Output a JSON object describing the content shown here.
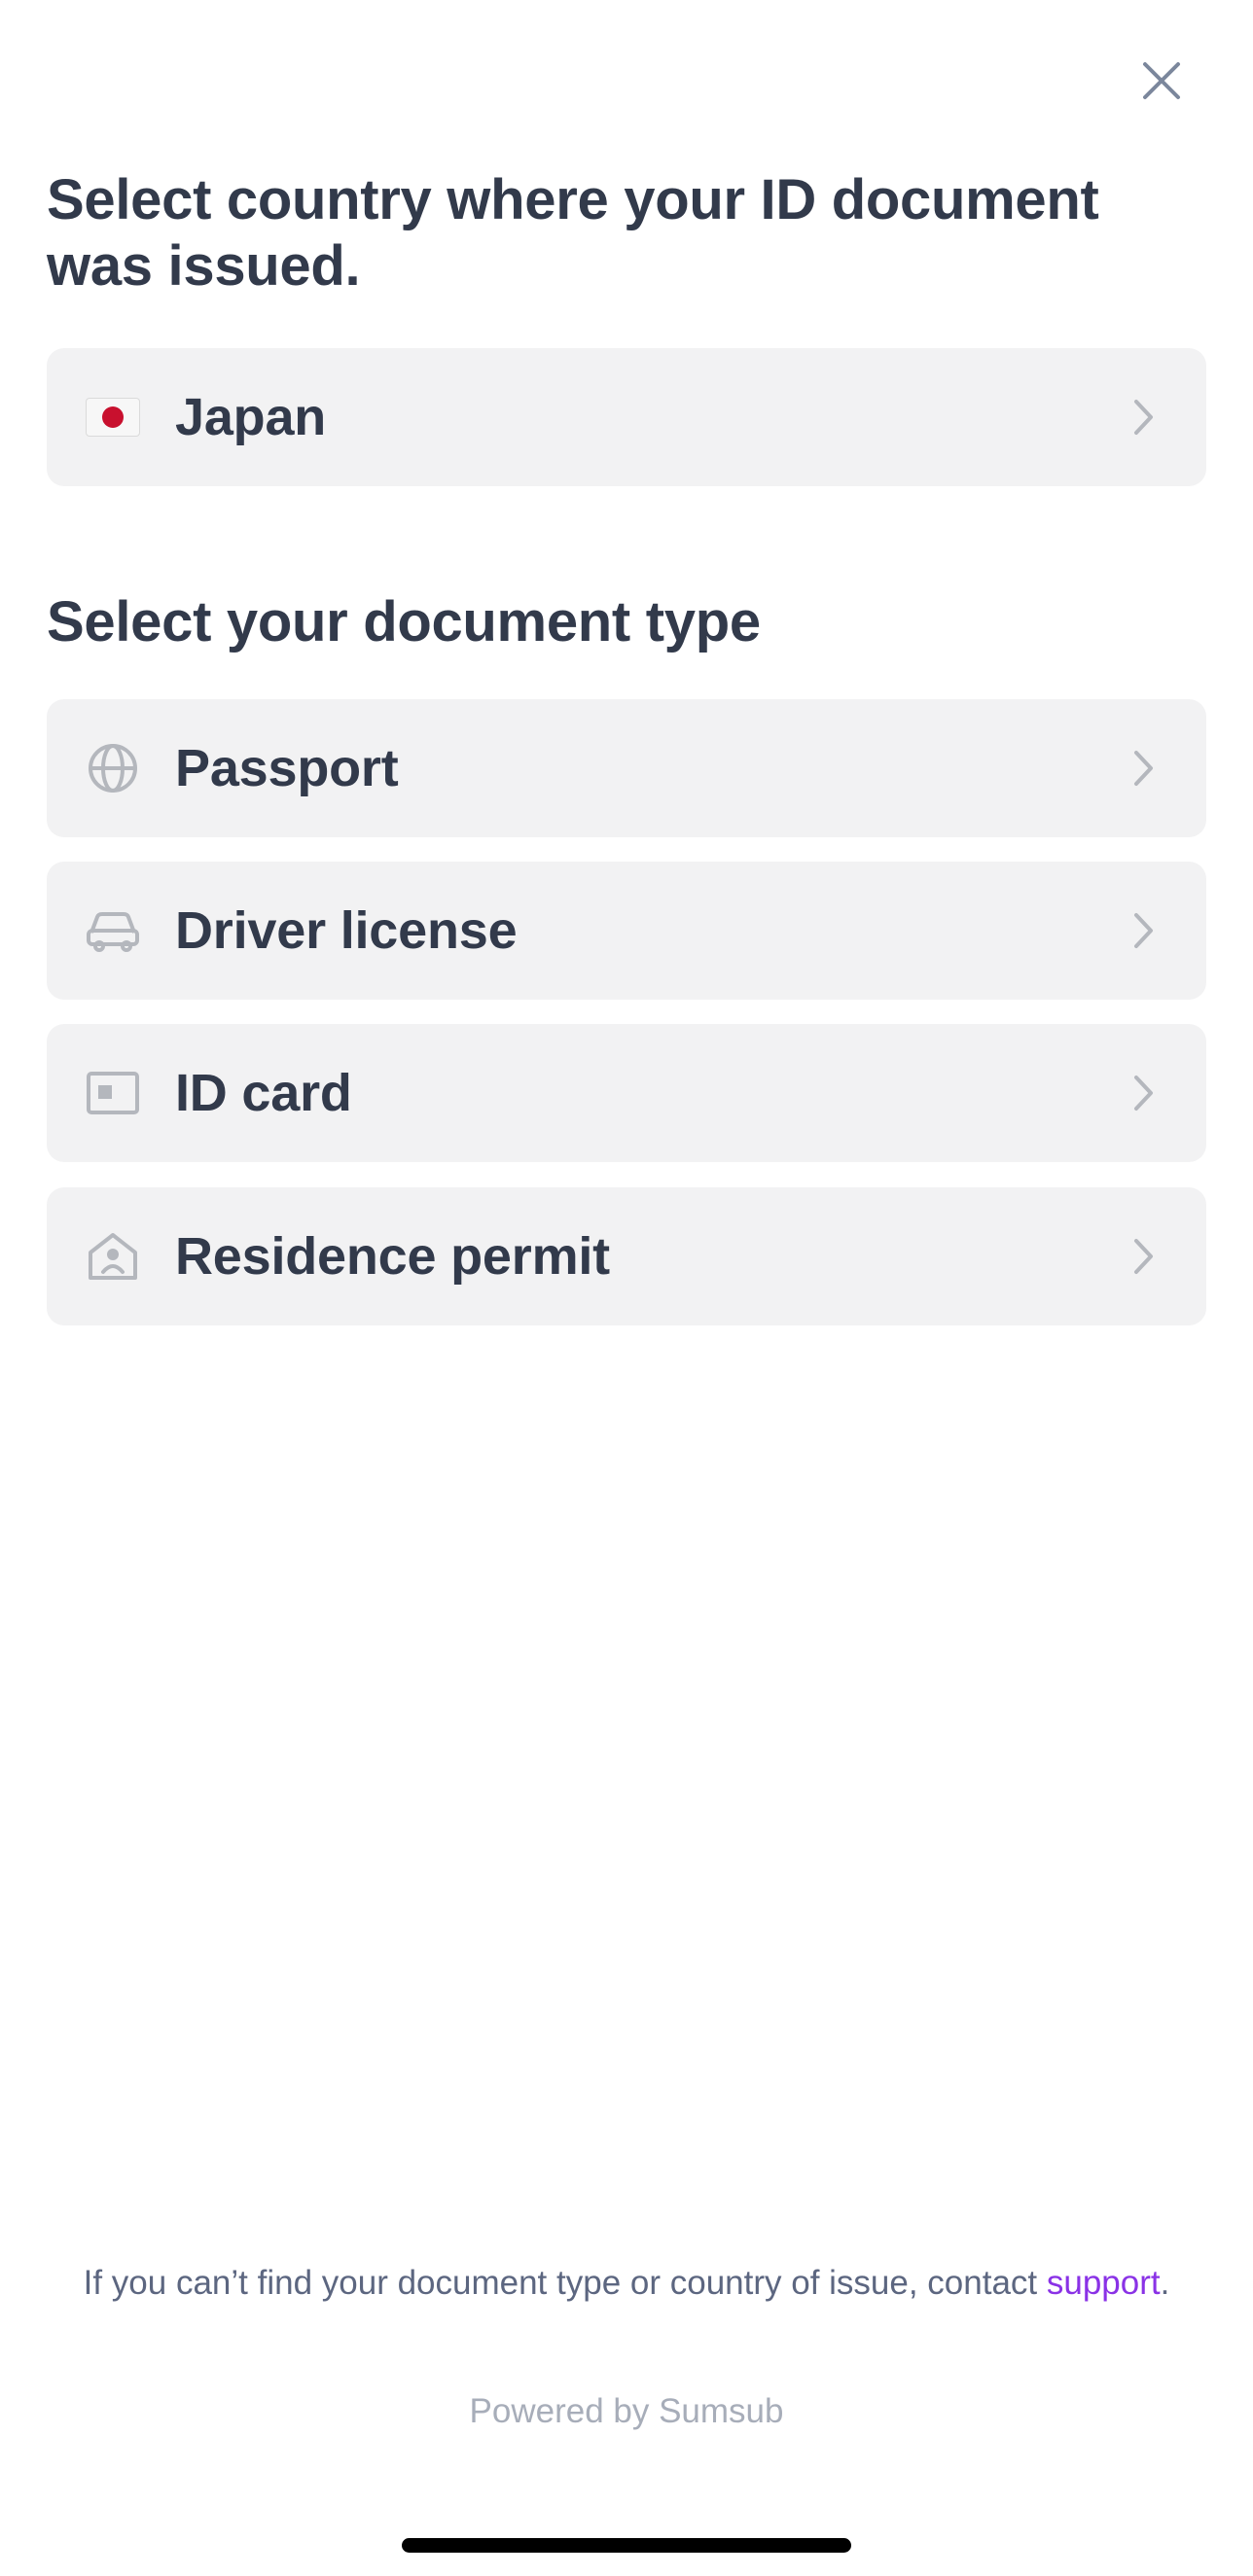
{
  "close_icon": "close-icon",
  "country_section": {
    "heading": "Select country where your ID document was issued.",
    "selected_country": {
      "name": "Japan",
      "flag_icon": "japan-flag-icon"
    }
  },
  "document_section": {
    "heading": "Select your document type",
    "types": [
      {
        "label": "Passport",
        "icon": "globe-icon"
      },
      {
        "label": "Driver license",
        "icon": "car-icon"
      },
      {
        "label": "ID card",
        "icon": "id-card-icon"
      },
      {
        "label": "Residence permit",
        "icon": "house-person-icon"
      }
    ]
  },
  "footer": {
    "note_text": "If you can’t find your document type or country of issue, contact ",
    "support_link": "support",
    "note_end": ".",
    "powered_by": "Powered by Sumsub"
  },
  "colors": {
    "text_primary": "#323a4b",
    "row_background": "#f2f2f3",
    "icon_gray": "#b4b7bd",
    "close_gray": "#7b879c",
    "link_purple": "#8a32e6",
    "muted_text": "#a7adb9"
  }
}
